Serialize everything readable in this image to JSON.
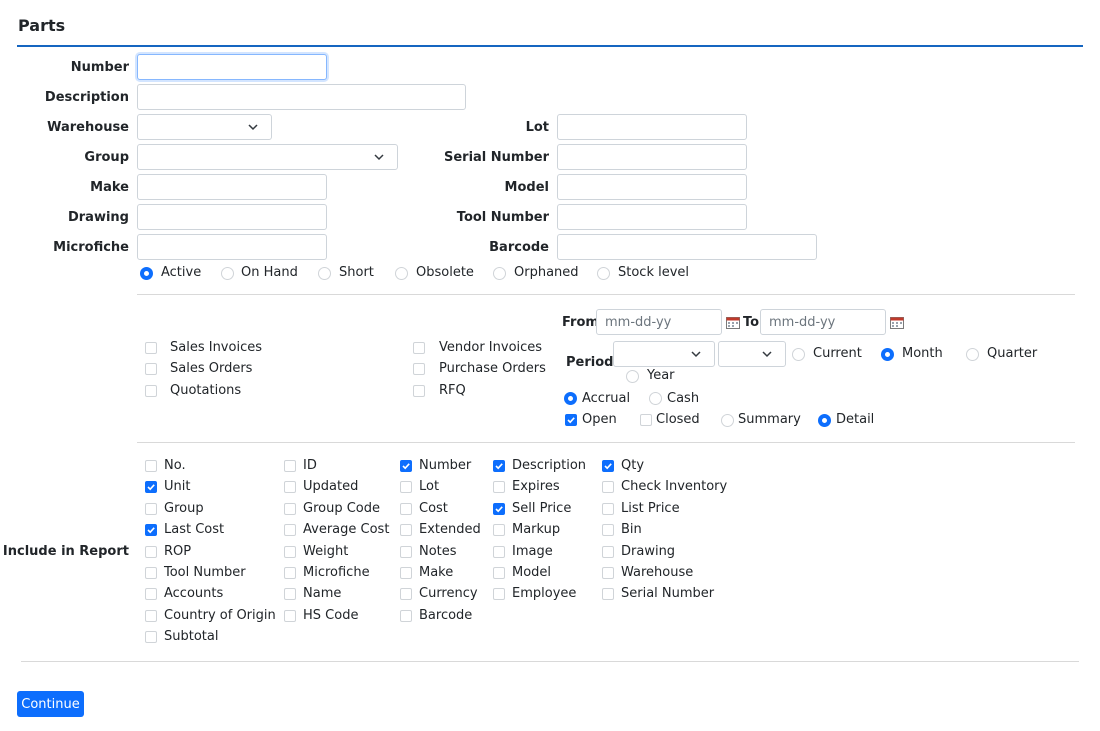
{
  "page": {
    "title": "Parts"
  },
  "fields": {
    "number": {
      "label": "Number",
      "value": ""
    },
    "description": {
      "label": "Description",
      "value": ""
    },
    "warehouse": {
      "label": "Warehouse",
      "value": ""
    },
    "group": {
      "label": "Group",
      "value": ""
    },
    "make": {
      "label": "Make",
      "value": ""
    },
    "drawing": {
      "label": "Drawing",
      "value": ""
    },
    "microfiche": {
      "label": "Microfiche",
      "value": ""
    },
    "lot": {
      "label": "Lot",
      "value": ""
    },
    "serial_number": {
      "label": "Serial Number",
      "value": ""
    },
    "model": {
      "label": "Model",
      "value": ""
    },
    "tool_number": {
      "label": "Tool Number",
      "value": ""
    },
    "barcode": {
      "label": "Barcode",
      "value": ""
    }
  },
  "status_options": [
    {
      "label": "Active",
      "selected": true
    },
    {
      "label": "On Hand",
      "selected": false
    },
    {
      "label": "Short",
      "selected": false
    },
    {
      "label": "Obsolete",
      "selected": false
    },
    {
      "label": "Orphaned",
      "selected": false
    },
    {
      "label": "Stock level",
      "selected": false
    }
  ],
  "document_types": [
    {
      "label": "Sales Invoices",
      "checked": false
    },
    {
      "label": "Sales Orders",
      "checked": false
    },
    {
      "label": "Quotations",
      "checked": false
    },
    {
      "label": "Vendor Invoices",
      "checked": false
    },
    {
      "label": "Purchase Orders",
      "checked": false
    },
    {
      "label": "RFQ",
      "checked": false
    }
  ],
  "dates": {
    "from_label": "From",
    "to_label": "To",
    "from_placeholder": "mm-dd-yy",
    "to_placeholder": "mm-dd-yy"
  },
  "period": {
    "label": "Period",
    "options": [
      {
        "label": "Current",
        "selected": false
      },
      {
        "label": "Month",
        "selected": true
      },
      {
        "label": "Quarter",
        "selected": false
      },
      {
        "label": "Year",
        "selected": false
      }
    ]
  },
  "method": [
    {
      "label": "Accrual",
      "selected": true
    },
    {
      "label": "Cash",
      "selected": false
    }
  ],
  "state": [
    {
      "label": "Open",
      "checked": true
    },
    {
      "label": "Closed",
      "checked": false
    }
  ],
  "detail_level": [
    {
      "label": "Summary",
      "selected": false
    },
    {
      "label": "Detail",
      "selected": true
    }
  ],
  "include_in_report": {
    "label": "Include in Report",
    "columns": [
      [
        {
          "label": "No.",
          "checked": false
        },
        {
          "label": "Unit",
          "checked": true
        },
        {
          "label": "Group",
          "checked": false
        },
        {
          "label": "Last Cost",
          "checked": true
        },
        {
          "label": "ROP",
          "checked": false
        },
        {
          "label": "Tool Number",
          "checked": false
        },
        {
          "label": "Accounts",
          "checked": false
        },
        {
          "label": "Country of Origin",
          "checked": false
        },
        {
          "label": "Subtotal",
          "checked": false
        }
      ],
      [
        {
          "label": "ID",
          "checked": false
        },
        {
          "label": "Updated",
          "checked": false
        },
        {
          "label": "Group Code",
          "checked": false
        },
        {
          "label": "Average Cost",
          "checked": false
        },
        {
          "label": "Weight",
          "checked": false
        },
        {
          "label": "Microfiche",
          "checked": false
        },
        {
          "label": "Name",
          "checked": false
        },
        {
          "label": "HS Code",
          "checked": false
        }
      ],
      [
        {
          "label": "Number",
          "checked": true
        },
        {
          "label": "Lot",
          "checked": false
        },
        {
          "label": "Cost",
          "checked": false
        },
        {
          "label": "Extended",
          "checked": false
        },
        {
          "label": "Notes",
          "checked": false
        },
        {
          "label": "Make",
          "checked": false
        },
        {
          "label": "Currency",
          "checked": false
        },
        {
          "label": "Barcode",
          "checked": false
        }
      ],
      [
        {
          "label": "Description",
          "checked": true
        },
        {
          "label": "Expires",
          "checked": false
        },
        {
          "label": "Sell Price",
          "checked": true
        },
        {
          "label": "Markup",
          "checked": false
        },
        {
          "label": "Image",
          "checked": false
        },
        {
          "label": "Model",
          "checked": false
        },
        {
          "label": "Employee",
          "checked": false
        }
      ],
      [
        {
          "label": "Qty",
          "checked": true
        },
        {
          "label": "Check Inventory",
          "checked": false
        },
        {
          "label": "List Price",
          "checked": false
        },
        {
          "label": "Bin",
          "checked": false
        },
        {
          "label": "Drawing",
          "checked": false
        },
        {
          "label": "Warehouse",
          "checked": false
        },
        {
          "label": "Serial Number",
          "checked": false
        }
      ]
    ]
  },
  "actions": {
    "continue_label": "Continue"
  },
  "colors": {
    "accent": "#0d6efd",
    "title_rule": "#1565c0"
  }
}
